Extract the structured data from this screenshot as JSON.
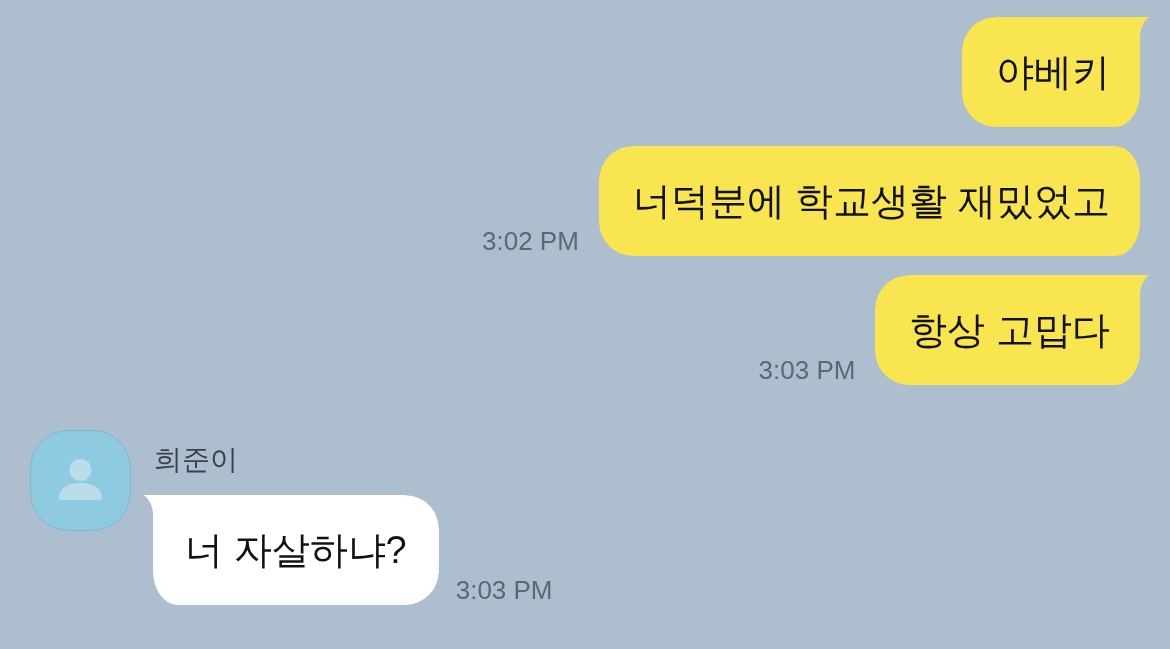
{
  "messages": [
    {
      "kind": "sent",
      "text": "야베키",
      "tail": true
    },
    {
      "kind": "sent",
      "text": "너덕분에 학교생활 재밌었고",
      "tail": false,
      "time": "3:02 PM"
    },
    {
      "kind": "sent",
      "text": "항상 고맙다",
      "tail": true,
      "time": "3:03 PM"
    },
    {
      "kind": "received",
      "sender": "희준이",
      "text": "너 자살하냐?",
      "tail": true,
      "time": "3:03 PM"
    }
  ]
}
